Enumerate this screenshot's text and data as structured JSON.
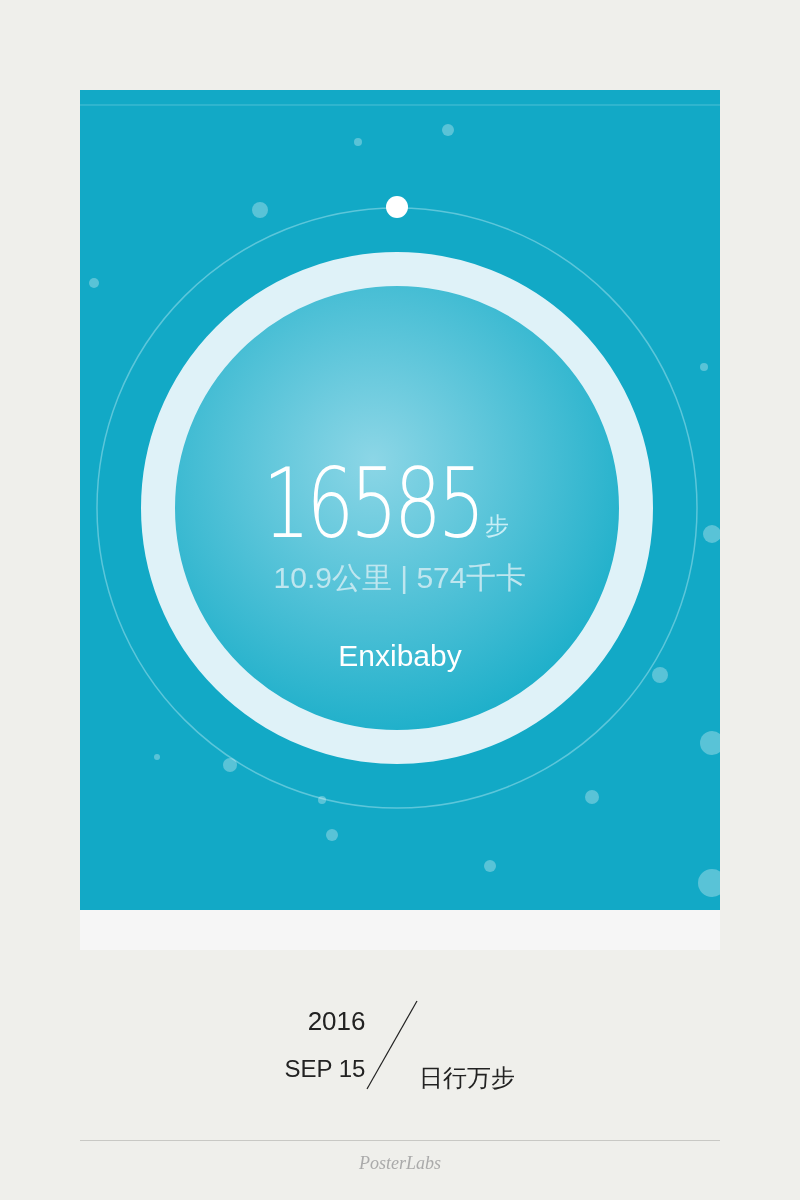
{
  "activity": {
    "steps": "16585",
    "steps_unit": "步",
    "summary": "10.9公里 | 574千卡",
    "user": "Enxibaby"
  },
  "caption": {
    "year": "2016",
    "date": "SEP 15",
    "slogan": "日行万步"
  },
  "footer": {
    "brand": "PosterLabs"
  }
}
